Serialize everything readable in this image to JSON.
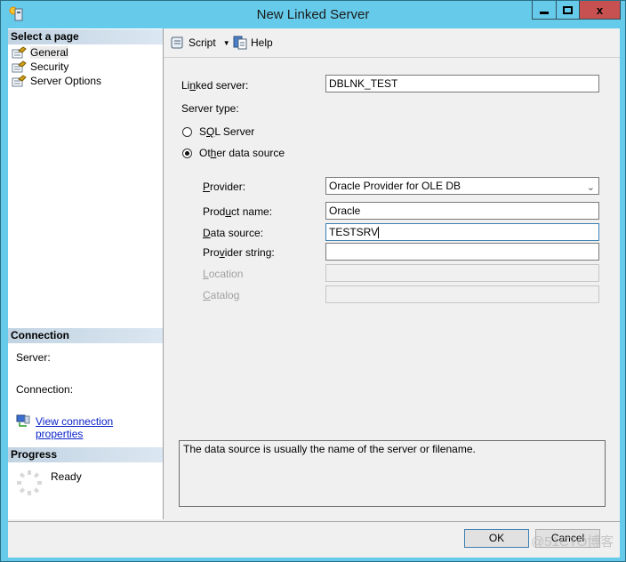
{
  "window": {
    "title": "New Linked Server",
    "controls": {
      "minimize": "minimize",
      "maximize": "maximize",
      "close": "close"
    }
  },
  "sidebar": {
    "select_page_header": "Select a page",
    "pages": [
      {
        "label": "General",
        "icon": "page-wrench-icon",
        "selected": true
      },
      {
        "label": "Security",
        "icon": "page-wrench-icon",
        "selected": false
      },
      {
        "label": "Server Options",
        "icon": "page-wrench-icon",
        "selected": false
      }
    ],
    "connection_header": "Connection",
    "server_label": "Server:",
    "connection_label": "Connection:",
    "view_connection_link": "View connection properties",
    "progress_header": "Progress",
    "progress_status": "Ready"
  },
  "toolbar": {
    "script_label": "Script",
    "help_label": "Help"
  },
  "form": {
    "linked_server_label": "Linked server:",
    "linked_server_value": "DBLNK_TEST",
    "server_type_label": "Server type:",
    "server_types": [
      {
        "label": "SQL Server",
        "selected": false
      },
      {
        "label": "Other data source",
        "selected": true
      }
    ],
    "provider_label": "Provider:",
    "provider_value": "Oracle Provider for OLE DB",
    "product_name_label": "Product name:",
    "product_name_value": "Oracle",
    "data_source_label": "Data source:",
    "data_source_value": "TESTSRV",
    "provider_string_label": "Provider string:",
    "provider_string_value": "",
    "location_label": "Location",
    "location_value": "",
    "catalog_label": "Catalog",
    "catalog_value": ""
  },
  "description": "The data source is usually the name of the server or filename.",
  "buttons": {
    "ok": "OK",
    "cancel": "Cancel"
  },
  "watermark": "@51CTO博客"
}
